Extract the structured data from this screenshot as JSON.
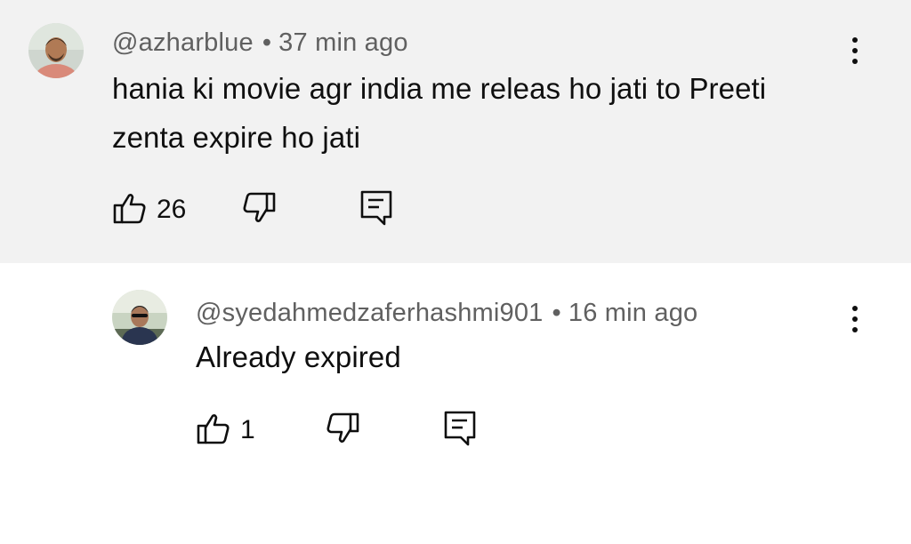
{
  "comments": [
    {
      "author": "@azharblue",
      "separator": "•",
      "time": "37 min ago",
      "text": "hania ki movie agr india me releas ho jati to Preeti zenta expire ho jati",
      "likes": "26",
      "icons": {
        "like": "thumbs-up-icon",
        "dislike": "thumbs-down-icon",
        "reply": "reply-comment-icon",
        "menu": "more-vertical-icon"
      }
    },
    {
      "author": "@syedahmedzaferhashmi901",
      "separator": "•",
      "time": "16 min ago",
      "text": "Already expired",
      "likes": "1",
      "icons": {
        "like": "thumbs-up-icon",
        "dislike": "thumbs-down-icon",
        "reply": "reply-comment-icon",
        "menu": "more-vertical-icon"
      }
    }
  ],
  "colors": {
    "top_background": "#f2f2f2",
    "reply_background": "#ffffff",
    "meta_text": "#606060",
    "body_text": "#0f0f0f"
  }
}
